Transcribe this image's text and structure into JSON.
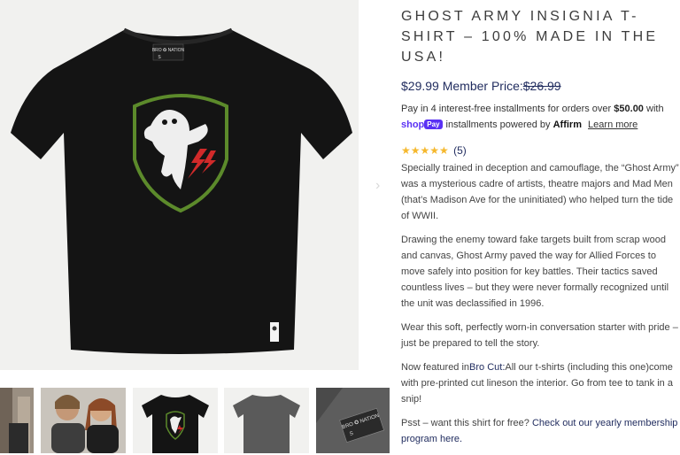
{
  "gallery": {
    "next_glyph": "›",
    "tag_brand": "BRO ✪ NATION",
    "tag_size": "S"
  },
  "product": {
    "title": "Ghost Army Insignia T-Shirt – 100% Made in the USA!",
    "price_current": "$29.99",
    "price_label": "Member Price:",
    "price_original": "$26.99",
    "installments_prefix": "Pay in 4 interest-free installments for orders over",
    "installments_amount": "$50.00",
    "installments_with": "with",
    "shop_text": "shop",
    "pay_text": "Pay",
    "installments_powered": "installments powered by",
    "affirm_text": "Affirm",
    "learn_more": "Learn more",
    "stars": "★★★★★",
    "review_count": "(5)",
    "desc_1": "Specially trained in deception and camouflage, the “Ghost Army” was a mysterious cadre of artists, theatre majors and Mad Men (that’s Madison Ave for the uninitiated) who helped turn the tide of WWII.",
    "desc_2": "Drawing the enemy toward fake targets built from scrap wood and canvas, Ghost Army paved the way for Allied Forces to move safely into position for key battles. Their tactics saved countless lives – but they were never formally recognized until the unit was declassified in 1996.",
    "desc_3": "Wear this soft, perfectly worn-in conversation starter with pride – just be prepared to tell the story.",
    "desc_4_prefix": "Now featured in",
    "desc_4_link": "Bro Cut:",
    "desc_4_rest": "All our t-shirts (including this one)come with pre-printed cut lineson the interior. Go from tee to tank in a snip!",
    "desc_5_prefix": "Psst – want this shirt for free?",
    "desc_5_link": "Check out our yearly membership program here."
  },
  "colors": {
    "navy": "#1f2b5e",
    "star": "#f5b82e",
    "shop_pay": "#5a31f4",
    "shirt": "#141414",
    "shield_green": "#5c8a2b",
    "bolt_red": "#d12a2a"
  }
}
